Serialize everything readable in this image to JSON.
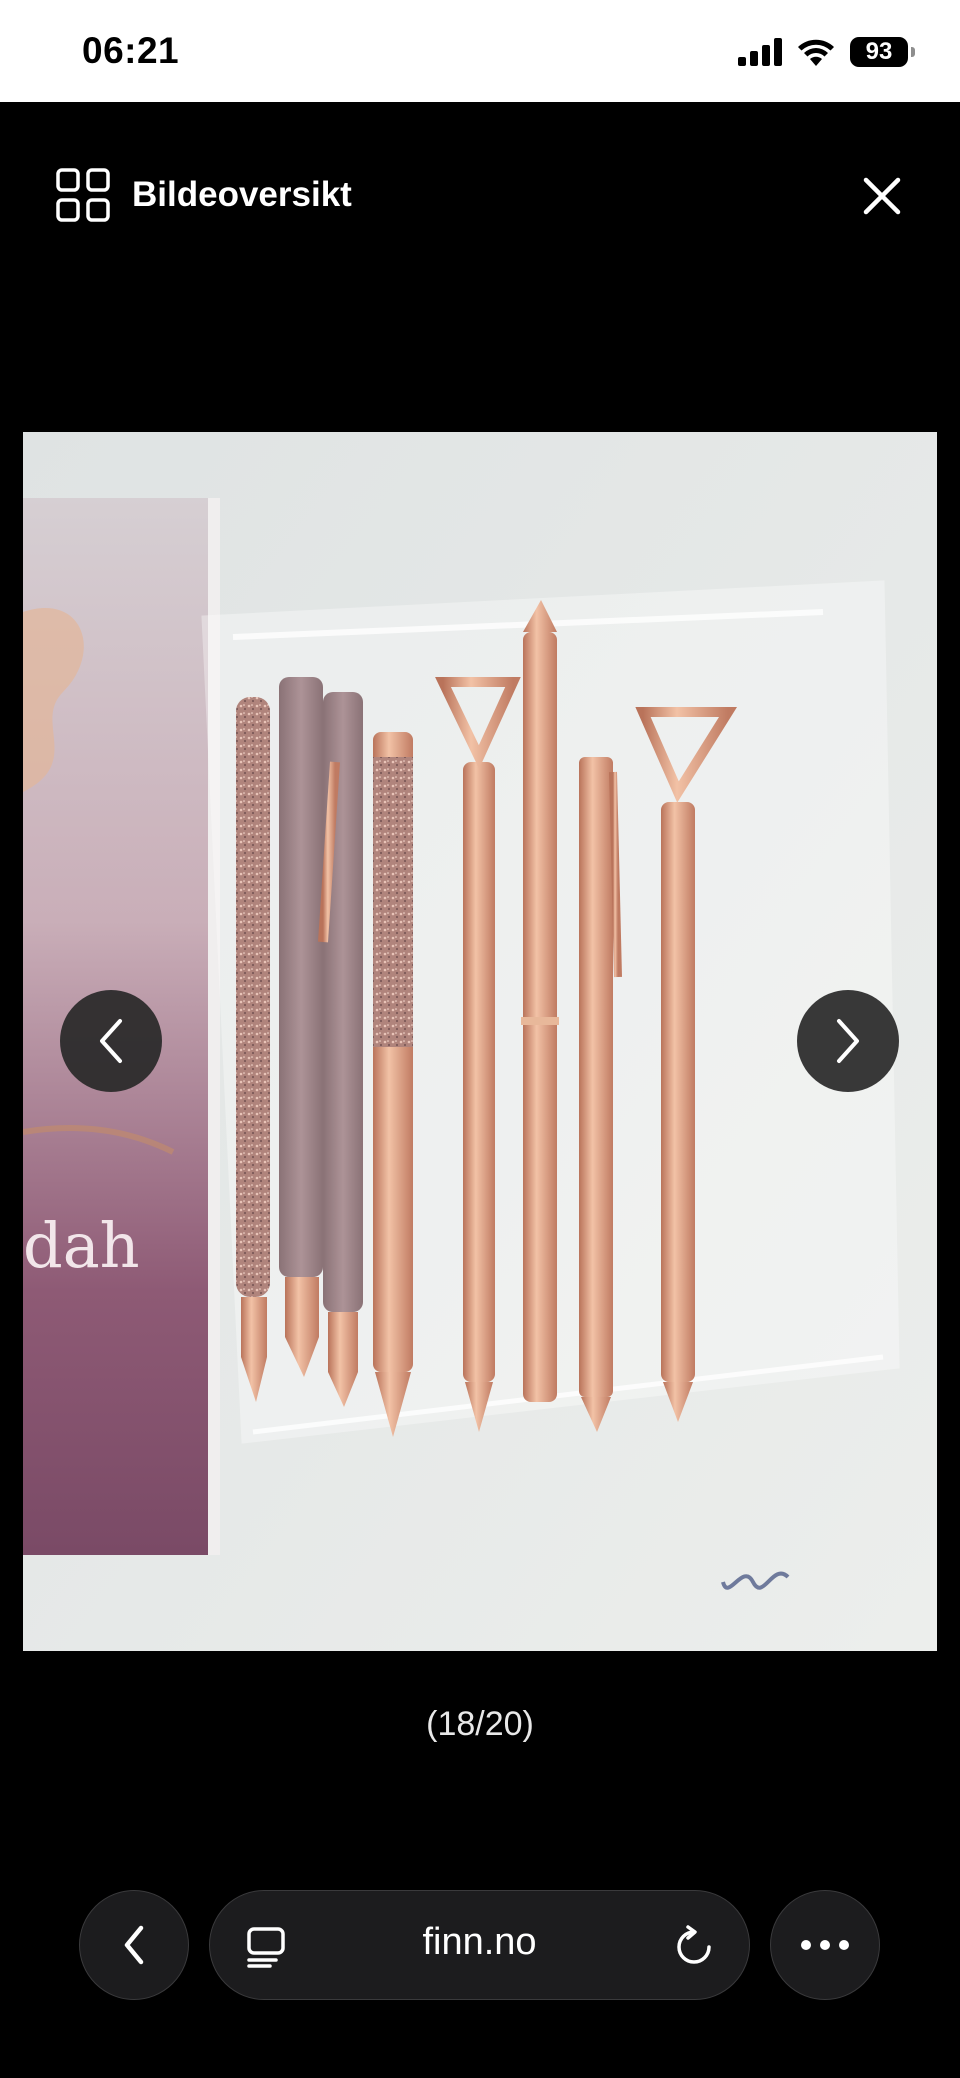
{
  "status_bar": {
    "time": "06:21",
    "battery": "93"
  },
  "viewer": {
    "overview_label": "Bildeoversikt",
    "counter": "(18/20)",
    "photo_text": "dah"
  },
  "browser": {
    "url": "finn.no"
  },
  "icons": {
    "signal": "cellular-signal-icon",
    "wifi": "wifi-icon",
    "battery": "battery-icon",
    "overview": "grid-icon",
    "close": "close-icon",
    "prev": "chevron-left-icon",
    "next": "chevron-right-icon",
    "back": "back-icon",
    "reader": "reader-icon",
    "reload": "reload-icon",
    "more": "more-icon"
  }
}
